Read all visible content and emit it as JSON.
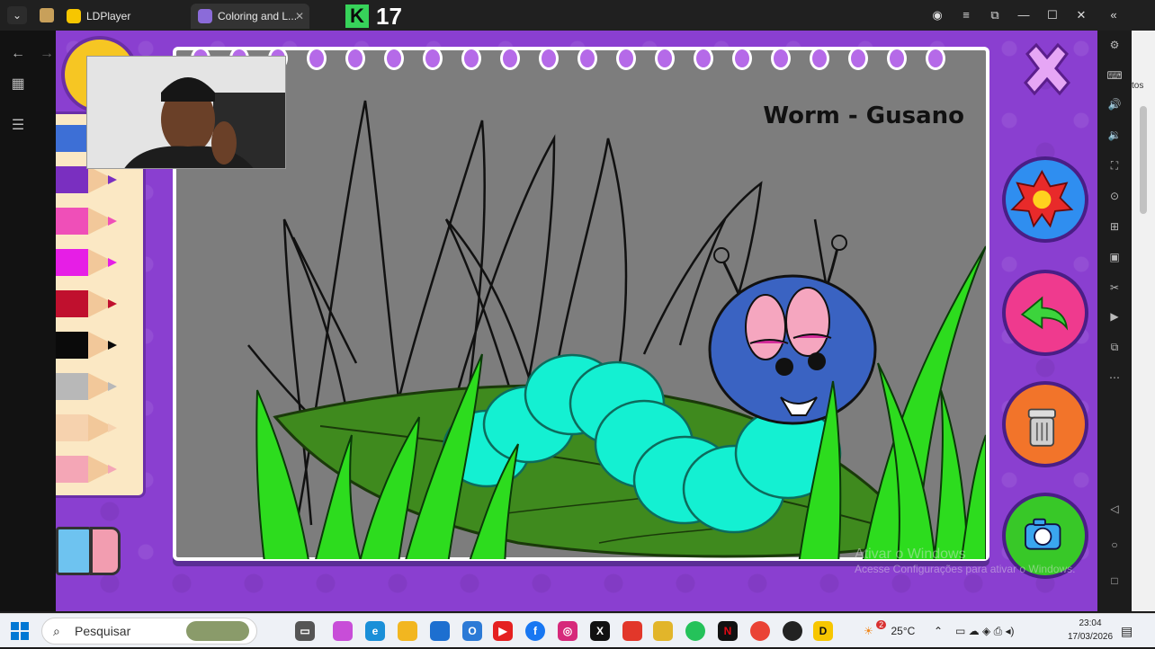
{
  "titlebar": {
    "tabs": [
      {
        "label": "LDPlayer"
      },
      {
        "label": "Coloring and L..."
      }
    ],
    "score": "17",
    "score_logo": "K"
  },
  "game": {
    "page_title": "Worm - Gusano",
    "pencil_colors": [
      "#3d6fd6",
      "#7a2fc0",
      "#ef4fb8",
      "#e61ee6",
      "#c0102e",
      "#0a0a0a",
      "#b8b8b8",
      "#f6d2ae",
      "#f4a6b6"
    ],
    "buttons": {
      "stamp": "star-stamp-icon",
      "undo": "undo-arrow-icon",
      "trash": "trash-can-icon",
      "camera": "camera-icon",
      "close": "close-icon"
    }
  },
  "watermark": {
    "line1": "Ativar o Windows",
    "line2": "Acesse Configurações para ativar o Windows."
  },
  "right_edge": {
    "ghost_text": "tos"
  },
  "taskbar": {
    "search_placeholder": "Pesquisar",
    "weather": "25°C",
    "weather_badge": "2",
    "time": "23:04",
    "date": "17/03/2026"
  }
}
